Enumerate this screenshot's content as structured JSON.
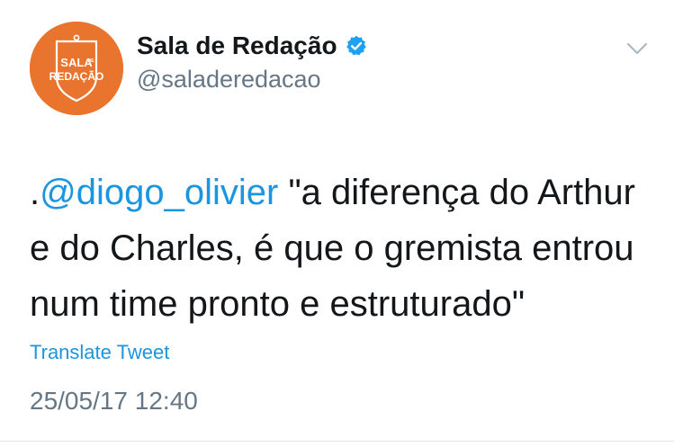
{
  "account": {
    "display_name": "Sala de Redação",
    "handle": "@saladeredacao",
    "avatar": {
      "line1": "SALA",
      "connector": "DE",
      "line2": "REDAÇÃO",
      "bg_color": "#e8742d"
    },
    "verified": true,
    "verified_color": "#1da1f2"
  },
  "tweet": {
    "prefix": ".",
    "mention": "@diogo_olivier",
    "line1_rest": " \"a diferença do Arthur",
    "line2": "e do Charles, é que o gremista entrou",
    "line3": "num time pronto e estruturado\""
  },
  "actions": {
    "translate_label": "Translate Tweet",
    "menu_icon": "chevron-down-icon"
  },
  "timestamp": "25/05/17 12:40",
  "colors": {
    "link": "#1b95e0",
    "secondary": "#657786",
    "text": "#14171a"
  }
}
